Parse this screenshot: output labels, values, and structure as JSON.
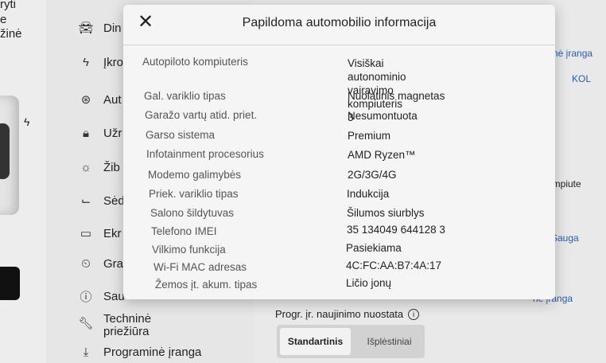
{
  "left_strip": {
    "frag1": "ryti",
    "frag2": "e",
    "frag3": "žinė"
  },
  "sidebar": {
    "items": [
      {
        "label": "Din",
        "icon": "car-icon"
      },
      {
        "label": "Įkro",
        "icon": "bolt-icon"
      },
      {
        "label": "Aut",
        "icon": "steering-wheel-icon"
      },
      {
        "label": "Užr",
        "icon": "lock-icon"
      },
      {
        "label": "Žib",
        "icon": "sun-icon"
      },
      {
        "label": "Sėd",
        "icon": "seat-icon"
      },
      {
        "label": "Ekr",
        "icon": "display-icon"
      },
      {
        "label": "Gra",
        "icon": "clock-icon"
      },
      {
        "label": "Sau",
        "icon": "alert-icon"
      },
      {
        "label": "Techninė priežiūra",
        "icon": "wrench-icon"
      },
      {
        "label": "Programinė įranga",
        "icon": "download-icon"
      }
    ]
  },
  "main": {
    "right_frag1": "nė įranga",
    "right_frag2": "KOL",
    "right_frag3": "kompiute",
    "right_frag4": "Sauga",
    "right_frag5": "nė įranga",
    "prog_label": "Progr. įr. naujinimo nuostata",
    "seg_selected": "Standartinis",
    "seg_other": "Išplėstiniai"
  },
  "modal": {
    "title": "Papildoma automobilio informacija",
    "rows": [
      {
        "label": "Autopiloto kompiuteris",
        "value": "Visiškai autonominio vairavimo\nkompiuteris 3"
      },
      {
        "label": "Gal. variklio tipas",
        "value": "Nuolatinis magnetas"
      },
      {
        "label": "Garažo vartų atid. priet.",
        "value": "Nesumontuota"
      },
      {
        "label": "Garso sistema",
        "value": "Premium"
      },
      {
        "label": "Infotainment procesorius",
        "value": "AMD Ryzen™"
      },
      {
        "label": "Modemo galimybės",
        "value": "2G/3G/4G"
      },
      {
        "label": "Priek. variklio tipas",
        "value": "Indukcija"
      },
      {
        "label": "Salono šildytuvas",
        "value": "Šilumos siurblys"
      },
      {
        "label": "Telefono IMEI",
        "value": "35 134049 644128 3"
      },
      {
        "label": "Vilkimo funkcija",
        "value": "Pasiekiama"
      },
      {
        "label": "Wi-Fi MAC adresas",
        "value": "4C:FC:AA:B7:4A:17"
      },
      {
        "label": "Žemos įt. akum. tipas",
        "value": "Ličio jonų"
      }
    ]
  }
}
